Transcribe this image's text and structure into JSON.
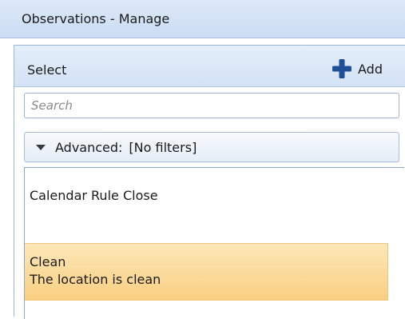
{
  "window": {
    "title": "Observations - Manage"
  },
  "select_panel": {
    "header_label": "Select",
    "add_label": "Add",
    "search": {
      "placeholder": "Search",
      "value": ""
    },
    "advanced": {
      "label": "Advanced:",
      "filter_value": "[No filters]"
    },
    "items": [
      {
        "title": "Calendar Rule Close",
        "description": ""
      },
      {
        "title": "Clean",
        "description": "The location is clean",
        "selected": true
      }
    ]
  },
  "colors": {
    "title_bar": "#cadcf3",
    "selection": "#f9cf82",
    "add_icon": "#1f4f97"
  },
  "icons": {
    "add": "plus-icon",
    "expand": "triangle-down-icon"
  }
}
